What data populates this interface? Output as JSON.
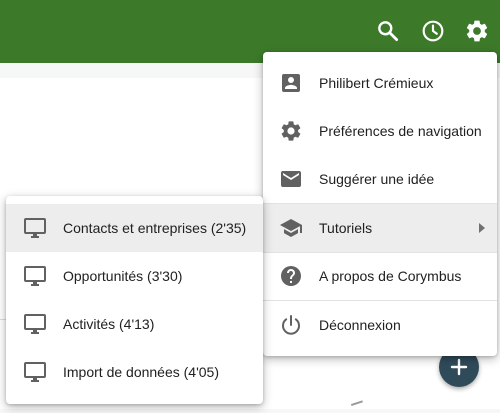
{
  "topbar": {
    "icons": [
      "search-icon",
      "history-icon",
      "settings-icon"
    ],
    "color": "#3c7a2a"
  },
  "main_menu": {
    "items": [
      {
        "label": "Philibert Crémieux",
        "icon": "account-box-icon"
      },
      {
        "label": "Préférences de navigation",
        "icon": "settings-icon"
      },
      {
        "label": "Suggérer une idée",
        "icon": "mail-icon"
      },
      {
        "label": "Tutoriels",
        "icon": "school-icon",
        "has_submenu": true,
        "highlighted": true
      },
      {
        "label": "A propos de Corymbus",
        "icon": "help-icon"
      },
      {
        "label": "Déconnexion",
        "icon": "power-icon"
      }
    ]
  },
  "submenu": {
    "items": [
      {
        "label": "Contacts et entreprises (2'35)",
        "icon": "monitor-icon",
        "highlighted": true
      },
      {
        "label": "Opportunités (3'30)",
        "icon": "monitor-icon"
      },
      {
        "label": "Activités (4'13)",
        "icon": "monitor-icon"
      },
      {
        "label": "Import de données (4'05)",
        "icon": "monitor-icon"
      }
    ]
  },
  "fab": {
    "icon": "plus-icon",
    "color": "#2f4b5a"
  }
}
